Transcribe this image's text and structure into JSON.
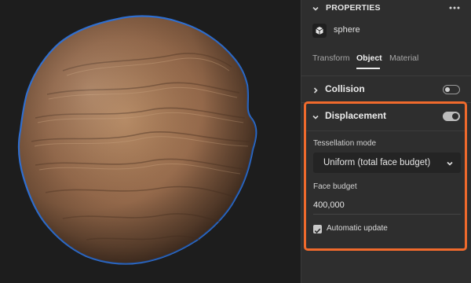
{
  "viewport": {
    "selection_outline_color": "#2f6fd1",
    "object": "sphere"
  },
  "panel": {
    "header": {
      "title": "PROPERTIES",
      "more_icon": "more-horizontal-icon"
    },
    "object": {
      "icon": "cube-icon",
      "name": "sphere"
    },
    "tabs": [
      {
        "label": "Transform",
        "active": false
      },
      {
        "label": "Object",
        "active": true
      },
      {
        "label": "Material",
        "active": false
      }
    ],
    "collision": {
      "title": "Collision",
      "expanded": false,
      "enabled": false
    },
    "displacement": {
      "title": "Displacement",
      "expanded": true,
      "enabled": true,
      "highlight_color": "#f06a2c",
      "tessellation_label": "Tessellation mode",
      "tessellation_value": "Uniform (total face budget)",
      "face_budget_label": "Face budget",
      "face_budget_value": "400,000",
      "auto_update_label": "Automatic update",
      "auto_update_checked": true
    }
  }
}
